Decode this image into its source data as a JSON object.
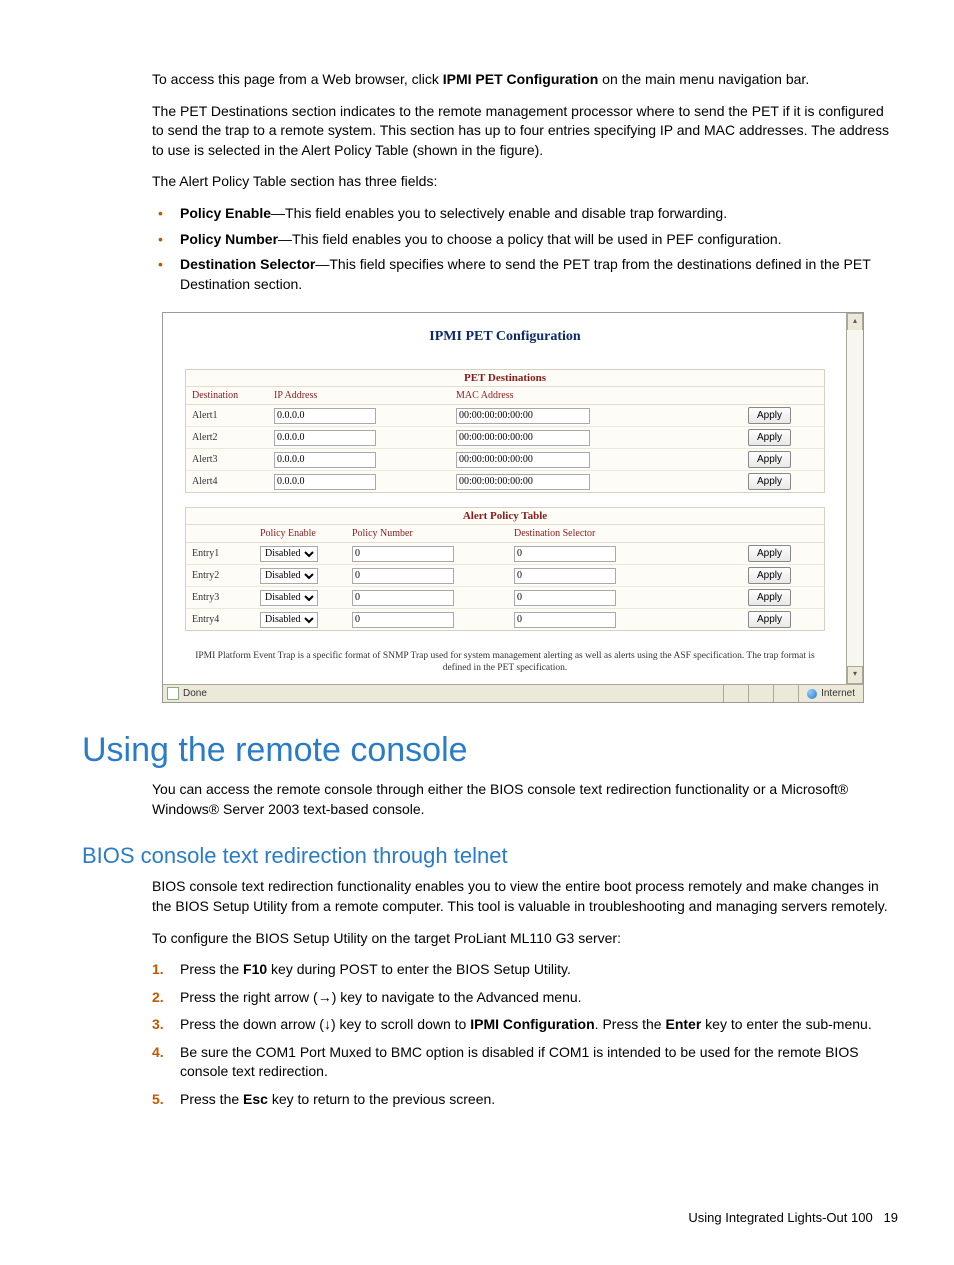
{
  "intro": {
    "p1_a": "To access this page from a Web browser, click ",
    "p1_b": "IPMI PET Configuration",
    "p1_c": " on the main menu navigation bar.",
    "p2": "The PET Destinations section indicates to the remote management processor where to send the PET if it is configured to send the trap to a remote system. This section has up to four entries specifying IP and MAC addresses. The address to use is selected in the Alert Policy Table (shown in the figure).",
    "p3": "The Alert Policy Table section has three fields:"
  },
  "bullets": [
    {
      "term": "Policy Enable",
      "text": "—This field enables you to selectively enable and disable trap forwarding."
    },
    {
      "term": "Policy Number",
      "text": "—This field enables you to choose a policy that will be used in PEF configuration."
    },
    {
      "term": "Destination Selector",
      "text": "—This field specifies where to send the PET trap from the destinations defined in the PET Destination section."
    }
  ],
  "figure": {
    "title": "IPMI PET Configuration",
    "section1": {
      "title": "PET Destinations",
      "headers": [
        "Destination",
        "IP Address",
        "MAC Address",
        ""
      ],
      "rows": [
        {
          "dest": "Alert1",
          "ip": "0.0.0.0",
          "mac": "00:00:00:00:00:00",
          "btn": "Apply"
        },
        {
          "dest": "Alert2",
          "ip": "0.0.0.0",
          "mac": "00:00:00:00:00:00",
          "btn": "Apply"
        },
        {
          "dest": "Alert3",
          "ip": "0.0.0.0",
          "mac": "00:00:00:00:00:00",
          "btn": "Apply"
        },
        {
          "dest": "Alert4",
          "ip": "0.0.0.0",
          "mac": "00:00:00:00:00:00",
          "btn": "Apply"
        }
      ]
    },
    "section2": {
      "title": "Alert Policy Table",
      "headers": [
        "",
        "Policy Enable",
        "Policy Number",
        "Destination Selector",
        ""
      ],
      "rows": [
        {
          "entry": "Entry1",
          "enable": "Disabled",
          "num": "0",
          "sel": "0",
          "btn": "Apply"
        },
        {
          "entry": "Entry2",
          "enable": "Disabled",
          "num": "0",
          "sel": "0",
          "btn": "Apply"
        },
        {
          "entry": "Entry3",
          "enable": "Disabled",
          "num": "0",
          "sel": "0",
          "btn": "Apply"
        },
        {
          "entry": "Entry4",
          "enable": "Disabled",
          "num": "0",
          "sel": "0",
          "btn": "Apply"
        }
      ]
    },
    "note": "IPMI Platform Event Trap is a specific format of SNMP Trap used for system management alerting as well as alerts using the ASF specification. The trap format is defined in the PET specification.",
    "status_done": "Done",
    "status_zone": "Internet"
  },
  "h1": "Using the remote console",
  "remote_p1": "You can access the remote console through either the BIOS console text redirection functionality or a Microsoft® Windows® Server 2003 text-based console.",
  "h2": "BIOS console text redirection through telnet",
  "bios_p1": "BIOS console text redirection functionality enables you to view the entire boot process remotely and make changes in the BIOS Setup Utility from a remote computer. This tool is valuable in troubleshooting and managing servers remotely.",
  "bios_p2": "To configure the BIOS Setup Utility on the target ProLiant ML110 G3 server:",
  "steps": {
    "s1_a": "Press the ",
    "s1_b": "F10",
    "s1_c": " key during POST to enter the BIOS Setup Utility.",
    "s2": "Press the right arrow (→) key to navigate to the Advanced menu.",
    "s3_a": "Press the down arrow (↓) key to scroll down to ",
    "s3_b": "IPMI Configuration",
    "s3_c": ". Press the ",
    "s3_d": "Enter",
    "s3_e": " key to enter the sub-menu.",
    "s4": "Be sure the COM1 Port Muxed to BMC option is disabled if COM1 is intended to be used for the remote BIOS console text redirection.",
    "s5_a": "Press the ",
    "s5_b": "Esc",
    "s5_c": " key to return to the previous screen."
  },
  "footer": {
    "text": "Using Integrated Lights-Out 100",
    "page": "19"
  }
}
